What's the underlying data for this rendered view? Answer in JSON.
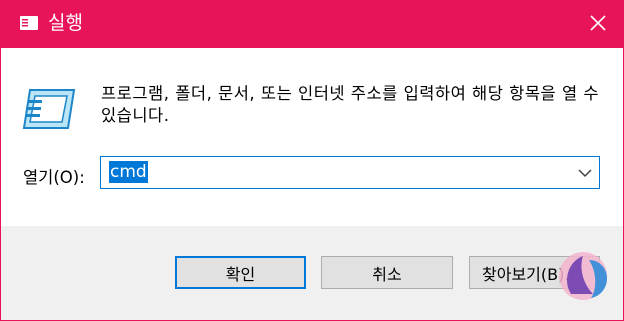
{
  "window": {
    "title": "실행",
    "accent_color": "#e8145a",
    "icons": {
      "app": "run-app-icon",
      "close": "close-icon",
      "run": "run-dialog-icon",
      "dropdown": "chevron-down-icon",
      "watermark": "watermark-logo"
    }
  },
  "dialog": {
    "description": "프로그램, 폴더, 문서, 또는 인터넷 주소를 입력하여 해당 항목을 열 수 있습니다.",
    "open_label": "열기(O):",
    "open_value": "cmd"
  },
  "buttons": {
    "ok": "확인",
    "cancel": "취소",
    "browse": "찾아보기(B)..."
  }
}
